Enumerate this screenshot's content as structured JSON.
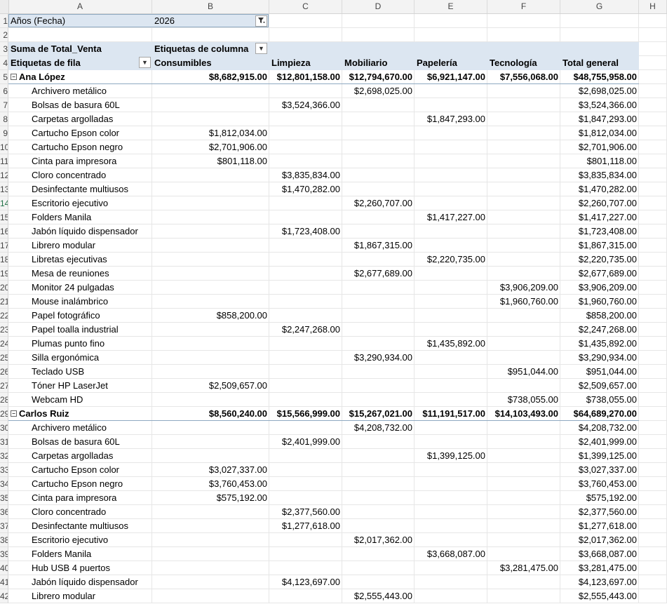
{
  "columns": [
    "A",
    "B",
    "C",
    "D",
    "E",
    "F",
    "G",
    "H"
  ],
  "filter": {
    "label": "Años (Fecha)",
    "value": "2026"
  },
  "pivot": {
    "values_label": "Suma de Total_Venta",
    "column_labels": "Etiquetas de columna",
    "row_labels": "Etiquetas de fila",
    "categories": [
      "Consumibles",
      "Limpieza",
      "Mobiliario",
      "Papelería",
      "Tecnología"
    ],
    "grand_total_label": "Total general"
  },
  "groups": [
    {
      "name": "Ana López",
      "totals": [
        "$8,682,915.00",
        "$12,801,158.00",
        "$12,794,670.00",
        "$6,921,147.00",
        "$7,556,068.00",
        "$48,755,958.00"
      ],
      "items": [
        {
          "name": "Archivero metálico",
          "values": [
            "",
            "",
            "$2,698,025.00",
            "",
            "",
            "$2,698,025.00"
          ]
        },
        {
          "name": "Bolsas de basura 60L",
          "values": [
            "",
            "$3,524,366.00",
            "",
            "",
            "",
            "$3,524,366.00"
          ]
        },
        {
          "name": "Carpetas argolladas",
          "values": [
            "",
            "",
            "",
            "$1,847,293.00",
            "",
            "$1,847,293.00"
          ]
        },
        {
          "name": "Cartucho Epson color",
          "values": [
            "$1,812,034.00",
            "",
            "",
            "",
            "",
            "$1,812,034.00"
          ]
        },
        {
          "name": "Cartucho Epson negro",
          "values": [
            "$2,701,906.00",
            "",
            "",
            "",
            "",
            "$2,701,906.00"
          ]
        },
        {
          "name": "Cinta para impresora",
          "values": [
            "$801,118.00",
            "",
            "",
            "",
            "",
            "$801,118.00"
          ]
        },
        {
          "name": "Cloro concentrado",
          "values": [
            "",
            "$3,835,834.00",
            "",
            "",
            "",
            "$3,835,834.00"
          ]
        },
        {
          "name": "Desinfectante multiusos",
          "values": [
            "",
            "$1,470,282.00",
            "",
            "",
            "",
            "$1,470,282.00"
          ]
        },
        {
          "name": "Escritorio ejecutivo",
          "values": [
            "",
            "",
            "$2,260,707.00",
            "",
            "",
            "$2,260,707.00"
          ]
        },
        {
          "name": "Folders Manila",
          "values": [
            "",
            "",
            "",
            "$1,417,227.00",
            "",
            "$1,417,227.00"
          ]
        },
        {
          "name": "Jabón líquido dispensador",
          "values": [
            "",
            "$1,723,408.00",
            "",
            "",
            "",
            "$1,723,408.00"
          ]
        },
        {
          "name": "Librero modular",
          "values": [
            "",
            "",
            "$1,867,315.00",
            "",
            "",
            "$1,867,315.00"
          ]
        },
        {
          "name": "Libretas ejecutivas",
          "values": [
            "",
            "",
            "",
            "$2,220,735.00",
            "",
            "$2,220,735.00"
          ]
        },
        {
          "name": "Mesa de reuniones",
          "values": [
            "",
            "",
            "$2,677,689.00",
            "",
            "",
            "$2,677,689.00"
          ]
        },
        {
          "name": "Monitor 24 pulgadas",
          "values": [
            "",
            "",
            "",
            "",
            "$3,906,209.00",
            "$3,906,209.00"
          ]
        },
        {
          "name": "Mouse inalámbrico",
          "values": [
            "",
            "",
            "",
            "",
            "$1,960,760.00",
            "$1,960,760.00"
          ]
        },
        {
          "name": "Papel fotográfico",
          "values": [
            "$858,200.00",
            "",
            "",
            "",
            "",
            "$858,200.00"
          ]
        },
        {
          "name": "Papel toalla industrial",
          "values": [
            "",
            "$2,247,268.00",
            "",
            "",
            "",
            "$2,247,268.00"
          ]
        },
        {
          "name": "Plumas punto fino",
          "values": [
            "",
            "",
            "",
            "$1,435,892.00",
            "",
            "$1,435,892.00"
          ]
        },
        {
          "name": "Silla ergonómica",
          "values": [
            "",
            "",
            "$3,290,934.00",
            "",
            "",
            "$3,290,934.00"
          ]
        },
        {
          "name": "Teclado USB",
          "values": [
            "",
            "",
            "",
            "",
            "$951,044.00",
            "$951,044.00"
          ]
        },
        {
          "name": "Tóner HP LaserJet",
          "values": [
            "$2,509,657.00",
            "",
            "",
            "",
            "",
            "$2,509,657.00"
          ]
        },
        {
          "name": "Webcam HD",
          "values": [
            "",
            "",
            "",
            "",
            "$738,055.00",
            "$738,055.00"
          ]
        }
      ]
    },
    {
      "name": "Carlos Ruiz",
      "totals": [
        "$8,560,240.00",
        "$15,566,999.00",
        "$15,267,021.00",
        "$11,191,517.00",
        "$14,103,493.00",
        "$64,689,270.00"
      ],
      "items": [
        {
          "name": "Archivero metálico",
          "values": [
            "",
            "",
            "$4,208,732.00",
            "",
            "",
            "$4,208,732.00"
          ]
        },
        {
          "name": "Bolsas de basura 60L",
          "values": [
            "",
            "$2,401,999.00",
            "",
            "",
            "",
            "$2,401,999.00"
          ]
        },
        {
          "name": "Carpetas argolladas",
          "values": [
            "",
            "",
            "",
            "$1,399,125.00",
            "",
            "$1,399,125.00"
          ]
        },
        {
          "name": "Cartucho Epson color",
          "values": [
            "$3,027,337.00",
            "",
            "",
            "",
            "",
            "$3,027,337.00"
          ]
        },
        {
          "name": "Cartucho Epson negro",
          "values": [
            "$3,760,453.00",
            "",
            "",
            "",
            "",
            "$3,760,453.00"
          ]
        },
        {
          "name": "Cinta para impresora",
          "values": [
            "$575,192.00",
            "",
            "",
            "",
            "",
            "$575,192.00"
          ]
        },
        {
          "name": "Cloro concentrado",
          "values": [
            "",
            "$2,377,560.00",
            "",
            "",
            "",
            "$2,377,560.00"
          ]
        },
        {
          "name": "Desinfectante multiusos",
          "values": [
            "",
            "$1,277,618.00",
            "",
            "",
            "",
            "$1,277,618.00"
          ]
        },
        {
          "name": "Escritorio ejecutivo",
          "values": [
            "",
            "",
            "$2,017,362.00",
            "",
            "",
            "$2,017,362.00"
          ]
        },
        {
          "name": "Folders Manila",
          "values": [
            "",
            "",
            "",
            "$3,668,087.00",
            "",
            "$3,668,087.00"
          ]
        },
        {
          "name": "Hub USB 4 puertos",
          "values": [
            "",
            "",
            "",
            "",
            "$3,281,475.00",
            "$3,281,475.00"
          ]
        },
        {
          "name": "Jabón líquido dispensador",
          "values": [
            "",
            "$4,123,697.00",
            "",
            "",
            "",
            "$4,123,697.00"
          ]
        },
        {
          "name": "Librero modular",
          "values": [
            "",
            "",
            "$2,555,443.00",
            "",
            "",
            "$2,555,443.00"
          ]
        }
      ]
    }
  ]
}
